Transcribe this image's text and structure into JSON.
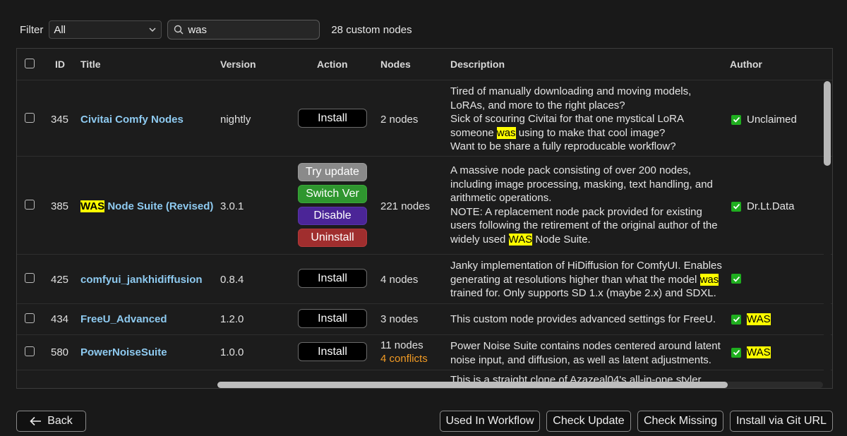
{
  "toolbar": {
    "filter_label": "Filter",
    "filter_value": "All",
    "search_value": "was",
    "count_text": "28 custom nodes"
  },
  "table": {
    "headers": {
      "id": "ID",
      "title": "Title",
      "version": "Version",
      "action": "Action",
      "nodes": "Nodes",
      "description": "Description",
      "author": "Author"
    },
    "rows": [
      {
        "id": "345",
        "title": "Civitai Comfy Nodes",
        "version": "nightly",
        "action": "Install",
        "nodes": "2 nodes",
        "author": "Unclaimed",
        "description": [
          "Tired of manually downloading and moving models,",
          "LoRAs, and more to the right places?",
          "Sick of scouring Civitai for that one mystical LoRA",
          "someone was using to make that cool image?",
          "Want to be share a fully reproducable workflow?"
        ]
      },
      {
        "id": "385",
        "title_highlight": "WAS",
        "title_rest": " Node Suite (Revised)",
        "version": "3.0.1",
        "actions": [
          "Try update",
          "Switch Ver",
          "Disable",
          "Uninstall"
        ],
        "nodes": "221 nodes",
        "author": "Dr.Lt.Data",
        "description": [
          "A massive node pack consisting of over 200 nodes,",
          "including image processing, masking, text handling, and",
          "arithmetic operations.",
          "NOTE: A replacement node pack provided for existing",
          "users following the retirement of the original author of the",
          "widely used WAS Node Suite."
        ]
      },
      {
        "id": "425",
        "title": "comfyui_jankhidiffusion",
        "version": "0.8.4",
        "action": "Install",
        "nodes": "4 nodes",
        "author": "",
        "description": [
          "Janky implementation of HiDiffusion for ComfyUI. Enables",
          "generating at resolutions higher than what the model was",
          "trained for. Only supports SD 1.x (maybe 2.x) and SDXL."
        ]
      },
      {
        "id": "434",
        "title": "FreeU_Advanced",
        "version": "1.2.0",
        "action": "Install",
        "nodes": "3 nodes",
        "author": "WAS",
        "description": [
          "This custom node provides advanced settings for FreeU."
        ]
      },
      {
        "id": "580",
        "title": "PowerNoiseSuite",
        "version": "1.0.0",
        "action": "Install",
        "nodes": "11 nodes",
        "conflicts": "4 conflicts",
        "author": "WAS",
        "description": [
          "Power Noise Suite contains nodes centered around latent",
          "noise input, and diffusion, as well as latent adjustments."
        ]
      },
      {
        "description_partial": "This is a straight clone of Azazeal04's all-in-one styler"
      }
    ]
  },
  "footer": {
    "back": "Back",
    "used_in_workflow": "Used In Workflow",
    "check_update": "Check Update",
    "check_missing": "Check Missing",
    "install_git": "Install via Git URL"
  },
  "colors": {
    "highlight": "#ffff00",
    "title_link": "#8ecaf0",
    "conflict": "#f29b24",
    "check": "#1fae1f"
  },
  "icons": [
    "chevron-down-icon",
    "search-icon",
    "checkbox-icon",
    "check-mark-icon",
    "arrow-left-icon"
  ]
}
